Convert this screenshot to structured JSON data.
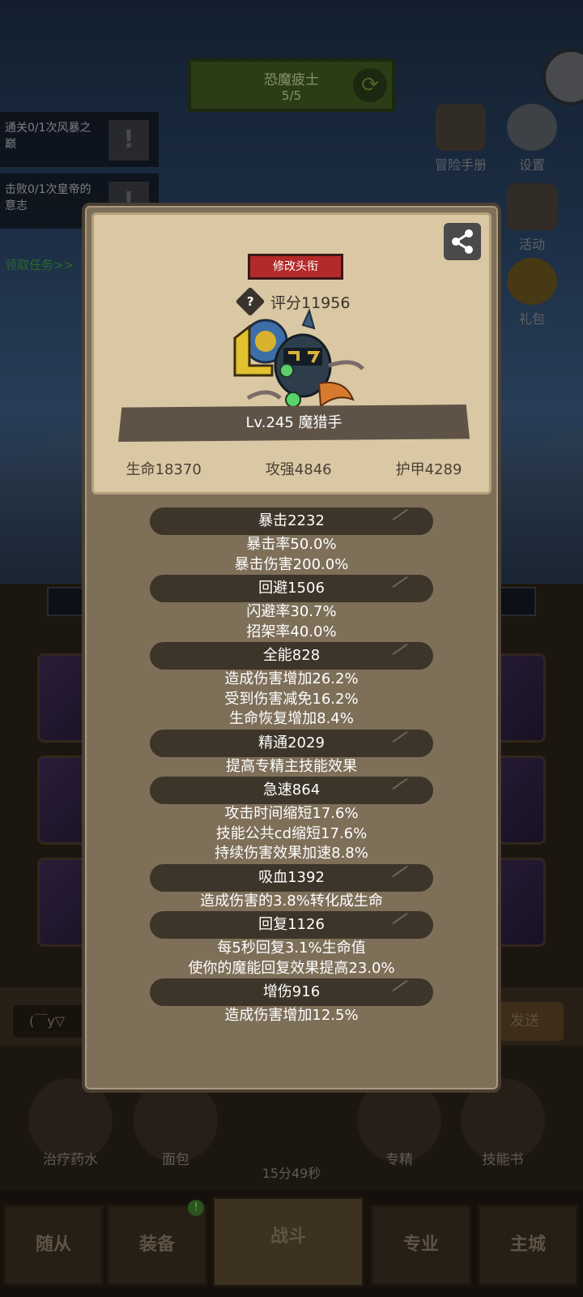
{
  "background": {
    "stage": {
      "name": "恐魔疲士",
      "count": "5/5"
    },
    "quests": [
      {
        "text": "通关0/1次风暴之巅"
      },
      {
        "text": "击败0/1次皇帝的意志"
      }
    ],
    "quest_link": "领取任务>>",
    "side_menu": [
      {
        "label": "冒险手册",
        "icon": "book-icon"
      },
      {
        "label": "设置",
        "icon": "gear-icon"
      },
      {
        "label": "活动",
        "icon": "scroll-icon"
      },
      {
        "label": "礼包",
        "icon": "gift-icon"
      }
    ],
    "chat": {
      "input_value": "(￣y▽",
      "send_label": "发送"
    },
    "items": [
      {
        "label": "治疗药水",
        "icon": "potion-icon"
      },
      {
        "label": "面包",
        "icon": "bread-icon"
      },
      {
        "label": "专精",
        "icon": "swap-icon"
      },
      {
        "label": "技能书",
        "icon": "skillbook-icon"
      }
    ],
    "timer": "15分49秒",
    "nav": [
      {
        "label": "随从"
      },
      {
        "label": "装备"
      },
      {
        "label": "战斗"
      },
      {
        "label": "专业"
      },
      {
        "label": "主城"
      }
    ]
  },
  "profile": {
    "rename_label": "修改头衔",
    "score": "评分11956",
    "name": "Lv.245 魔猎手",
    "hp": "生命18370",
    "attack": "攻强4846",
    "armor": "护甲4289"
  },
  "stat_groups": [
    {
      "title": "暴击2232",
      "lines": [
        "暴击率50.0%",
        "暴击伤害200.0%"
      ]
    },
    {
      "title": "回避1506",
      "lines": [
        "闪避率30.7%",
        "招架率40.0%"
      ]
    },
    {
      "title": "全能828",
      "lines": [
        "造成伤害增加26.2%",
        "受到伤害减免16.2%",
        "生命恢复增加8.4%"
      ]
    },
    {
      "title": "精通2029",
      "lines": [
        "提高专精主技能效果"
      ]
    },
    {
      "title": "急速864",
      "lines": [
        "攻击时间缩短17.6%",
        "技能公共cd缩短17.6%",
        "持续伤害效果加速8.8%"
      ]
    },
    {
      "title": "吸血1392",
      "lines": [
        "造成伤害的3.8%转化成生命"
      ]
    },
    {
      "title": "回复1126",
      "lines": [
        "每5秒回复3.1%生命值",
        "使你的魔能回复效果提高23.0%"
      ]
    },
    {
      "title": "增伤916",
      "lines": [
        "造成伤害增加12.5%"
      ]
    }
  ],
  "colors": {
    "modal_bg": "#7e6f59",
    "header_panel": "#d9c8a3",
    "rename_button": "#b42a2a",
    "group_head": "#3d3529"
  }
}
